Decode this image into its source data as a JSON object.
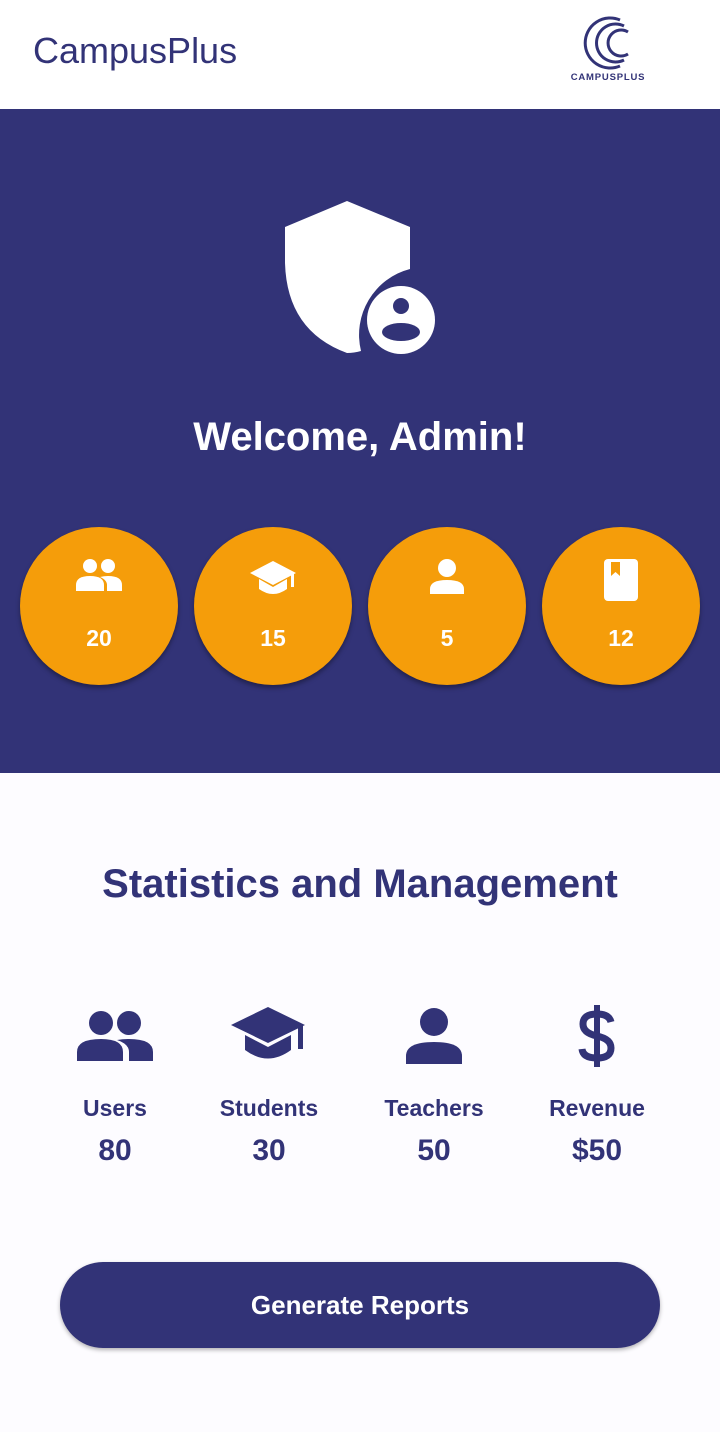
{
  "app": {
    "title": "CampusPlus",
    "logo_text": "CAMPUSPLUS"
  },
  "colors": {
    "primary": "#323377",
    "accent": "#f59d0a",
    "surface": "#ffffff",
    "background": "#fdfcff"
  },
  "hero": {
    "icon": "admin-shield-icon",
    "welcome": "Welcome, Admin!",
    "counters": [
      {
        "icon": "group-icon",
        "value": "20"
      },
      {
        "icon": "graduation-cap-icon",
        "value": "15"
      },
      {
        "icon": "person-icon",
        "value": "5"
      },
      {
        "icon": "book-icon",
        "value": "12"
      }
    ]
  },
  "stats": {
    "title": "Statistics and Management",
    "items": [
      {
        "icon": "group-icon",
        "label": "Users",
        "value": "80"
      },
      {
        "icon": "graduation-cap-icon",
        "label": "Students",
        "value": "30"
      },
      {
        "icon": "person-icon",
        "label": "Teachers",
        "value": "50"
      },
      {
        "icon": "dollar-icon",
        "label": "Revenue",
        "value": "$50"
      }
    ]
  },
  "actions": {
    "generate_reports": "Generate Reports"
  }
}
